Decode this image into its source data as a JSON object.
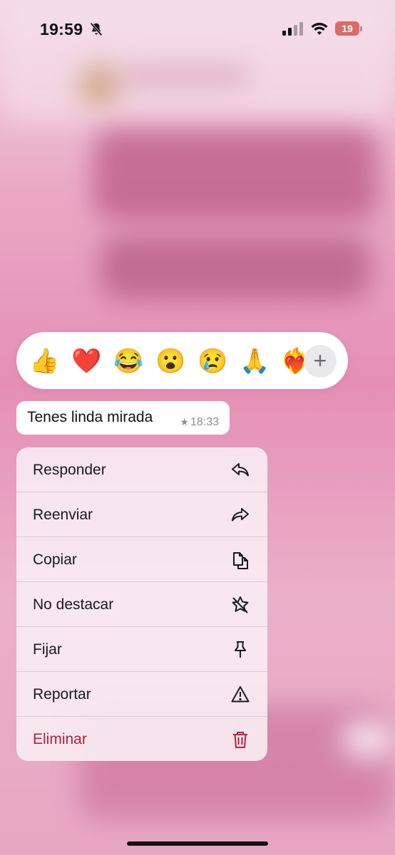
{
  "status_bar": {
    "time": "19:59",
    "battery_level": "19",
    "bell_icon": "bell-slash-icon",
    "signal_icon": "cellular-signal-icon",
    "wifi_icon": "wifi-icon"
  },
  "reactions": {
    "emojis": [
      "👍",
      "❤️",
      "😂",
      "😮",
      "😢",
      "🙏",
      "❤️‍🔥"
    ],
    "more_icon": "plus-icon",
    "more_label": "+"
  },
  "message": {
    "text": "Tenes linda mirada",
    "starred_icon": "star-icon",
    "time": "18:33"
  },
  "menu": {
    "items": [
      {
        "label": "Responder",
        "icon": "reply-icon"
      },
      {
        "label": "Reenviar",
        "icon": "forward-icon"
      },
      {
        "label": "Copiar",
        "icon": "copy-icon"
      },
      {
        "label": "No destacar",
        "icon": "unstar-icon"
      },
      {
        "label": "Fijar",
        "icon": "pin-icon"
      },
      {
        "label": "Reportar",
        "icon": "warning-icon"
      },
      {
        "label": "Eliminar",
        "icon": "trash-icon"
      }
    ]
  },
  "colors": {
    "danger": "#b1233d",
    "battery_low": "#d96b6b"
  }
}
